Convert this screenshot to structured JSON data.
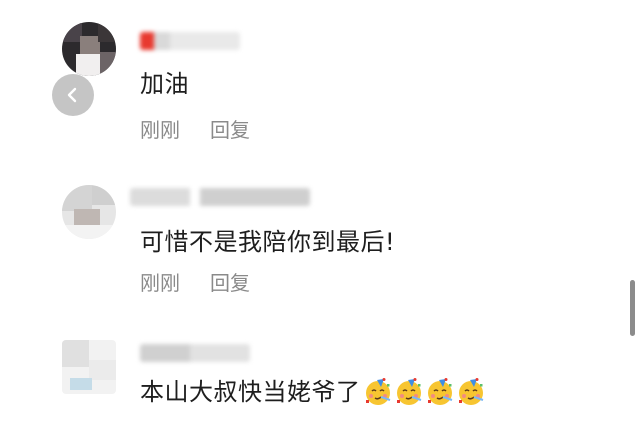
{
  "comments": [
    {
      "text": "加油",
      "time": "刚刚",
      "reply": "回复"
    },
    {
      "text": "可惜不是我陪你到最后!",
      "time": "刚刚",
      "reply": "回复"
    },
    {
      "text": "本山大叔快当姥爷了",
      "emoji": "partying-face-icon",
      "emoji_count": 4
    }
  ],
  "colors": {
    "text": "#1e1e1e",
    "meta": "#8a8a8a",
    "name_accent": "#e8392f"
  }
}
